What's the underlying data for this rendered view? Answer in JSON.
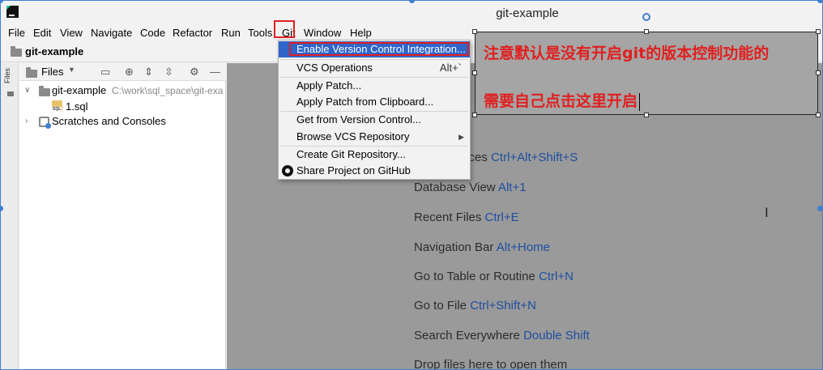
{
  "window": {
    "title": "git-example"
  },
  "menubar": [
    "File",
    "Edit",
    "View",
    "Navigate",
    "Code",
    "Refactor",
    "Run",
    "Tools",
    "Git",
    "Window",
    "Help"
  ],
  "navbar": {
    "project": "git-example"
  },
  "sidestrip": {
    "label": "Files"
  },
  "project_panel": {
    "view_selector": "Files",
    "tree": {
      "root": {
        "name": "git-example",
        "path": "C:\\work\\sql_space\\git-exa"
      },
      "file": "1.sql",
      "scratches": "Scratches and Consoles"
    }
  },
  "git_menu": {
    "items": [
      {
        "label": "Enable Version Control Integration...",
        "shortcut": ""
      },
      {
        "label": "VCS Operations",
        "shortcut": "Alt+`"
      },
      {
        "label": "Apply Patch...",
        "shortcut": ""
      },
      {
        "label": "Apply Patch from Clipboard...",
        "shortcut": ""
      },
      {
        "label": "Get from Version Control...",
        "shortcut": ""
      },
      {
        "label": "Browse VCS Repository",
        "shortcut": ""
      },
      {
        "label": "Create Git Repository...",
        "shortcut": ""
      },
      {
        "label": "Share Project on GitHub",
        "shortcut": ""
      }
    ],
    "selected_index": 0
  },
  "editor_hints": [
    {
      "text": "Data Sources",
      "key": "Ctrl+Alt+Shift+S"
    },
    {
      "text": "Database View",
      "key": "Alt+1"
    },
    {
      "text": "Recent Files",
      "key": "Ctrl+E"
    },
    {
      "text": "Navigation Bar",
      "key": "Alt+Home"
    },
    {
      "text": "Go to Table or Routine",
      "key": "Ctrl+N"
    },
    {
      "text": "Go to File",
      "key": "Ctrl+Shift+N"
    },
    {
      "text": "Search Everywhere",
      "key": "Double Shift"
    },
    {
      "text": "Drop files here to open them",
      "key": ""
    }
  ],
  "annotation": {
    "line1": "注意默认是没有开启git的版本控制功能的",
    "line2": "需要自己点击这里开启"
  },
  "colors": {
    "accent": "#2f65ca",
    "highlight_red": "#e02020",
    "shortcut_blue": "#1f4fa0"
  }
}
